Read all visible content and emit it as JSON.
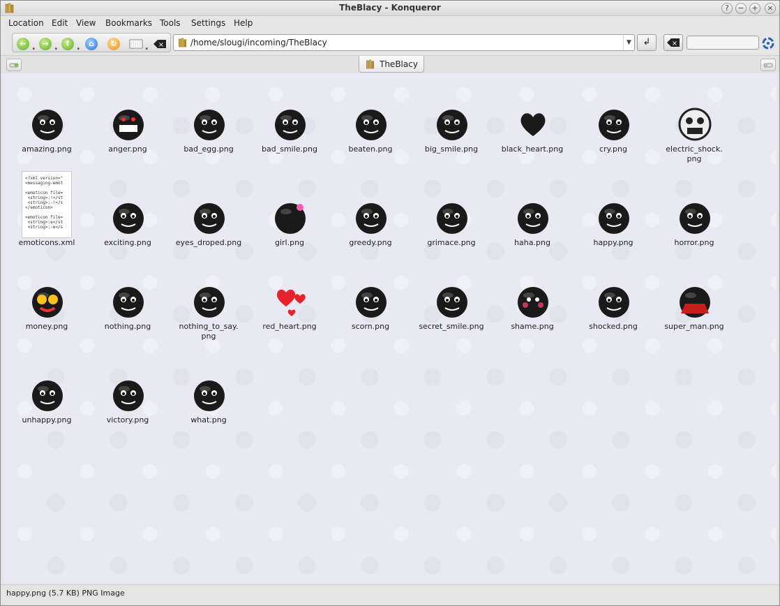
{
  "window": {
    "title": "TheBlacy - Konqueror",
    "buttons": {
      "help": "?",
      "minimize": "−",
      "maximize": "+",
      "close": "×"
    }
  },
  "menu": [
    "Location",
    "Edit",
    "View",
    "Bookmarks",
    "Tools",
    "Settings",
    "Help"
  ],
  "toolbar": {
    "url": "/home/slougi/incoming/TheBlacy",
    "search_value": ""
  },
  "tab": {
    "label": "TheBlacy"
  },
  "files": [
    {
      "name": "amazing.png",
      "line2": ""
    },
    {
      "name": "anger.png",
      "line2": ""
    },
    {
      "name": "bad_egg.png",
      "line2": ""
    },
    {
      "name": "bad_smile.png",
      "line2": ""
    },
    {
      "name": "beaten.png",
      "line2": ""
    },
    {
      "name": "big_smile.png",
      "line2": ""
    },
    {
      "name": "black_heart.png",
      "line2": ""
    },
    {
      "name": "cry.png",
      "line2": ""
    },
    {
      "name": "electric_shock.",
      "line2": "png"
    },
    {
      "name": "emoticons.xml",
      "line2": ""
    },
    {
      "name": "exciting.png",
      "line2": ""
    },
    {
      "name": "eyes_droped.png",
      "line2": ""
    },
    {
      "name": "girl.png",
      "line2": ""
    },
    {
      "name": "greedy.png",
      "line2": ""
    },
    {
      "name": "grimace.png",
      "line2": ""
    },
    {
      "name": "haha.png",
      "line2": ""
    },
    {
      "name": "happy.png",
      "line2": ""
    },
    {
      "name": "horror.png",
      "line2": ""
    },
    {
      "name": "money.png",
      "line2": ""
    },
    {
      "name": "nothing.png",
      "line2": ""
    },
    {
      "name": "nothing_to_say.",
      "line2": "png"
    },
    {
      "name": "red_heart.png",
      "line2": ""
    },
    {
      "name": "scorn.png",
      "line2": ""
    },
    {
      "name": "secret_smile.png",
      "line2": ""
    },
    {
      "name": "shame.png",
      "line2": ""
    },
    {
      "name": "shocked.png",
      "line2": ""
    },
    {
      "name": "super_man.png",
      "line2": ""
    },
    {
      "name": "unhappy.png",
      "line2": ""
    },
    {
      "name": "victory.png",
      "line2": ""
    },
    {
      "name": "what.png",
      "line2": ""
    }
  ],
  "xml_preview": "<?xml version=\"\n<messaging-emot\n\n<emoticon file=\n <string>:!</st\n <string>:-!</s\n</emoticon>\n\n<emoticon file=\n <string>:e</st\n <string>:-e</s",
  "status": "happy.png (5.7 KB)  PNG Image"
}
